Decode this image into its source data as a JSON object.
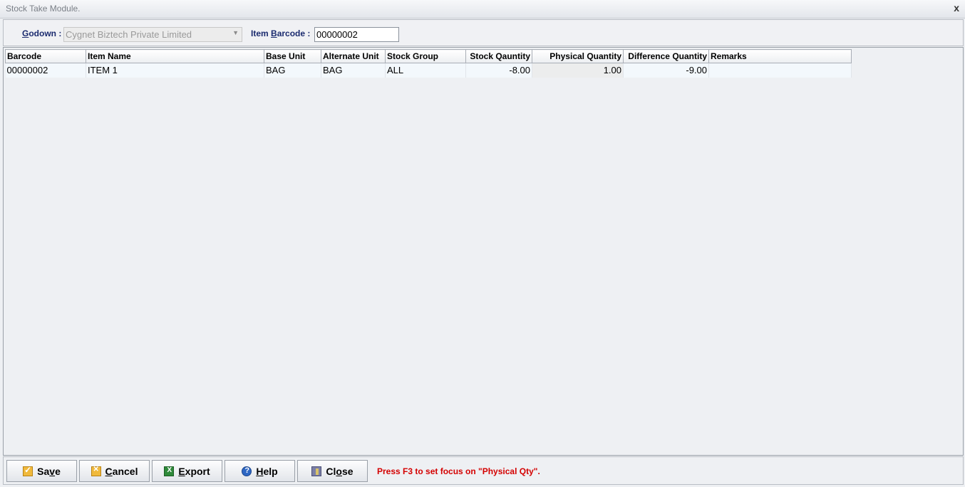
{
  "window": {
    "title": "Stock Take Module.",
    "close_glyph": "x"
  },
  "filter": {
    "godown_label_ul": "G",
    "godown_label_rest": "odown :",
    "godown_value": "Cygnet Biztech Private Limited",
    "barcode_label_pre": "Item ",
    "barcode_label_ul": "B",
    "barcode_label_rest": "arcode :",
    "barcode_value": "00000002"
  },
  "grid": {
    "columns": [
      "Barcode",
      "Item Name",
      "Base Unit",
      "Alternate Unit",
      "Stock Group",
      "Stock Qauntity",
      "Physical Quantity",
      "Difference Quantity",
      "Remarks"
    ],
    "rows": [
      [
        "00000002",
        "ITEM 1",
        "BAG",
        "BAG",
        "ALL",
        "-8.00",
        "1.00",
        "-9.00",
        ""
      ]
    ]
  },
  "toolbar": {
    "save": {
      "pre": "Sa",
      "ul": "v",
      "post": "e"
    },
    "cancel": {
      "pre": "",
      "ul": "C",
      "post": "ancel"
    },
    "export": {
      "pre": "",
      "ul": "E",
      "post": "xport"
    },
    "help": {
      "pre": "",
      "ul": "H",
      "post": "elp"
    },
    "close": {
      "pre": "Cl",
      "ul": "o",
      "post": "se"
    },
    "hint": "Press F3 to set focus on \"Physical Qty\"."
  },
  "colors": {
    "label": "#1a2a6e",
    "hint": "#d40000",
    "row_bg": "#f3f8fc"
  }
}
